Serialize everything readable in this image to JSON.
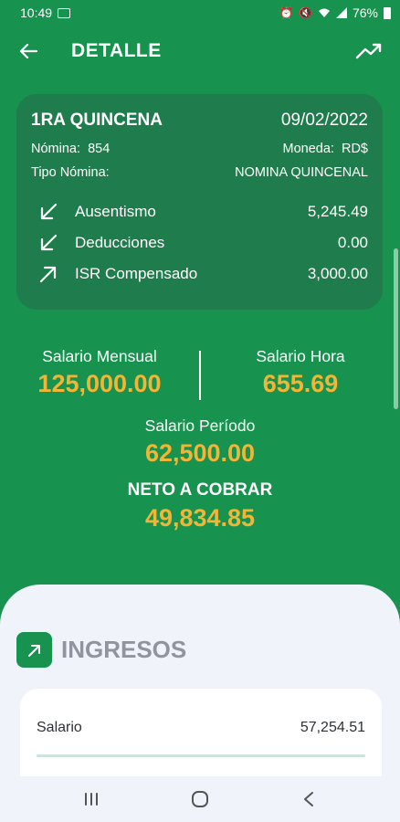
{
  "status_bar": {
    "time": "10:49",
    "battery": "76%"
  },
  "app_bar": {
    "title": "DETALLE"
  },
  "summary": {
    "period": "1RA QUINCENA",
    "date": "09/02/2022",
    "nomina_label": "Nómina:",
    "nomina_value": "854",
    "moneda_label": "Moneda:",
    "moneda_value": "RD$",
    "tipo_label": "Tipo Nómina:",
    "tipo_value": "NOMINA QUINCENAL",
    "items": [
      {
        "label": "Ausentismo",
        "value": "5,245.49",
        "icon": "arrow-down-left-icon"
      },
      {
        "label": "Deducciones",
        "value": "0.00",
        "icon": "arrow-down-left-icon"
      },
      {
        "label": "ISR Compensado",
        "value": "3,000.00",
        "icon": "arrow-up-right-icon"
      }
    ]
  },
  "salaries": {
    "mensual_label": "Salario Mensual",
    "mensual_value": "125,000.00",
    "hora_label": "Salario Hora",
    "hora_value": "655.69",
    "periodo_label": "Salario Período",
    "periodo_value": "62,500.00",
    "neto_label": "NETO A COBRAR",
    "neto_value": "49,834.85"
  },
  "ingresos": {
    "title": "INGRESOS",
    "rows": [
      {
        "label": "Salario",
        "value": "57,254.51"
      }
    ]
  },
  "colors": {
    "primary": "#18924f",
    "card": "#1f7c4c",
    "accent": "#f2b535",
    "sheet": "#f1f3fa"
  }
}
